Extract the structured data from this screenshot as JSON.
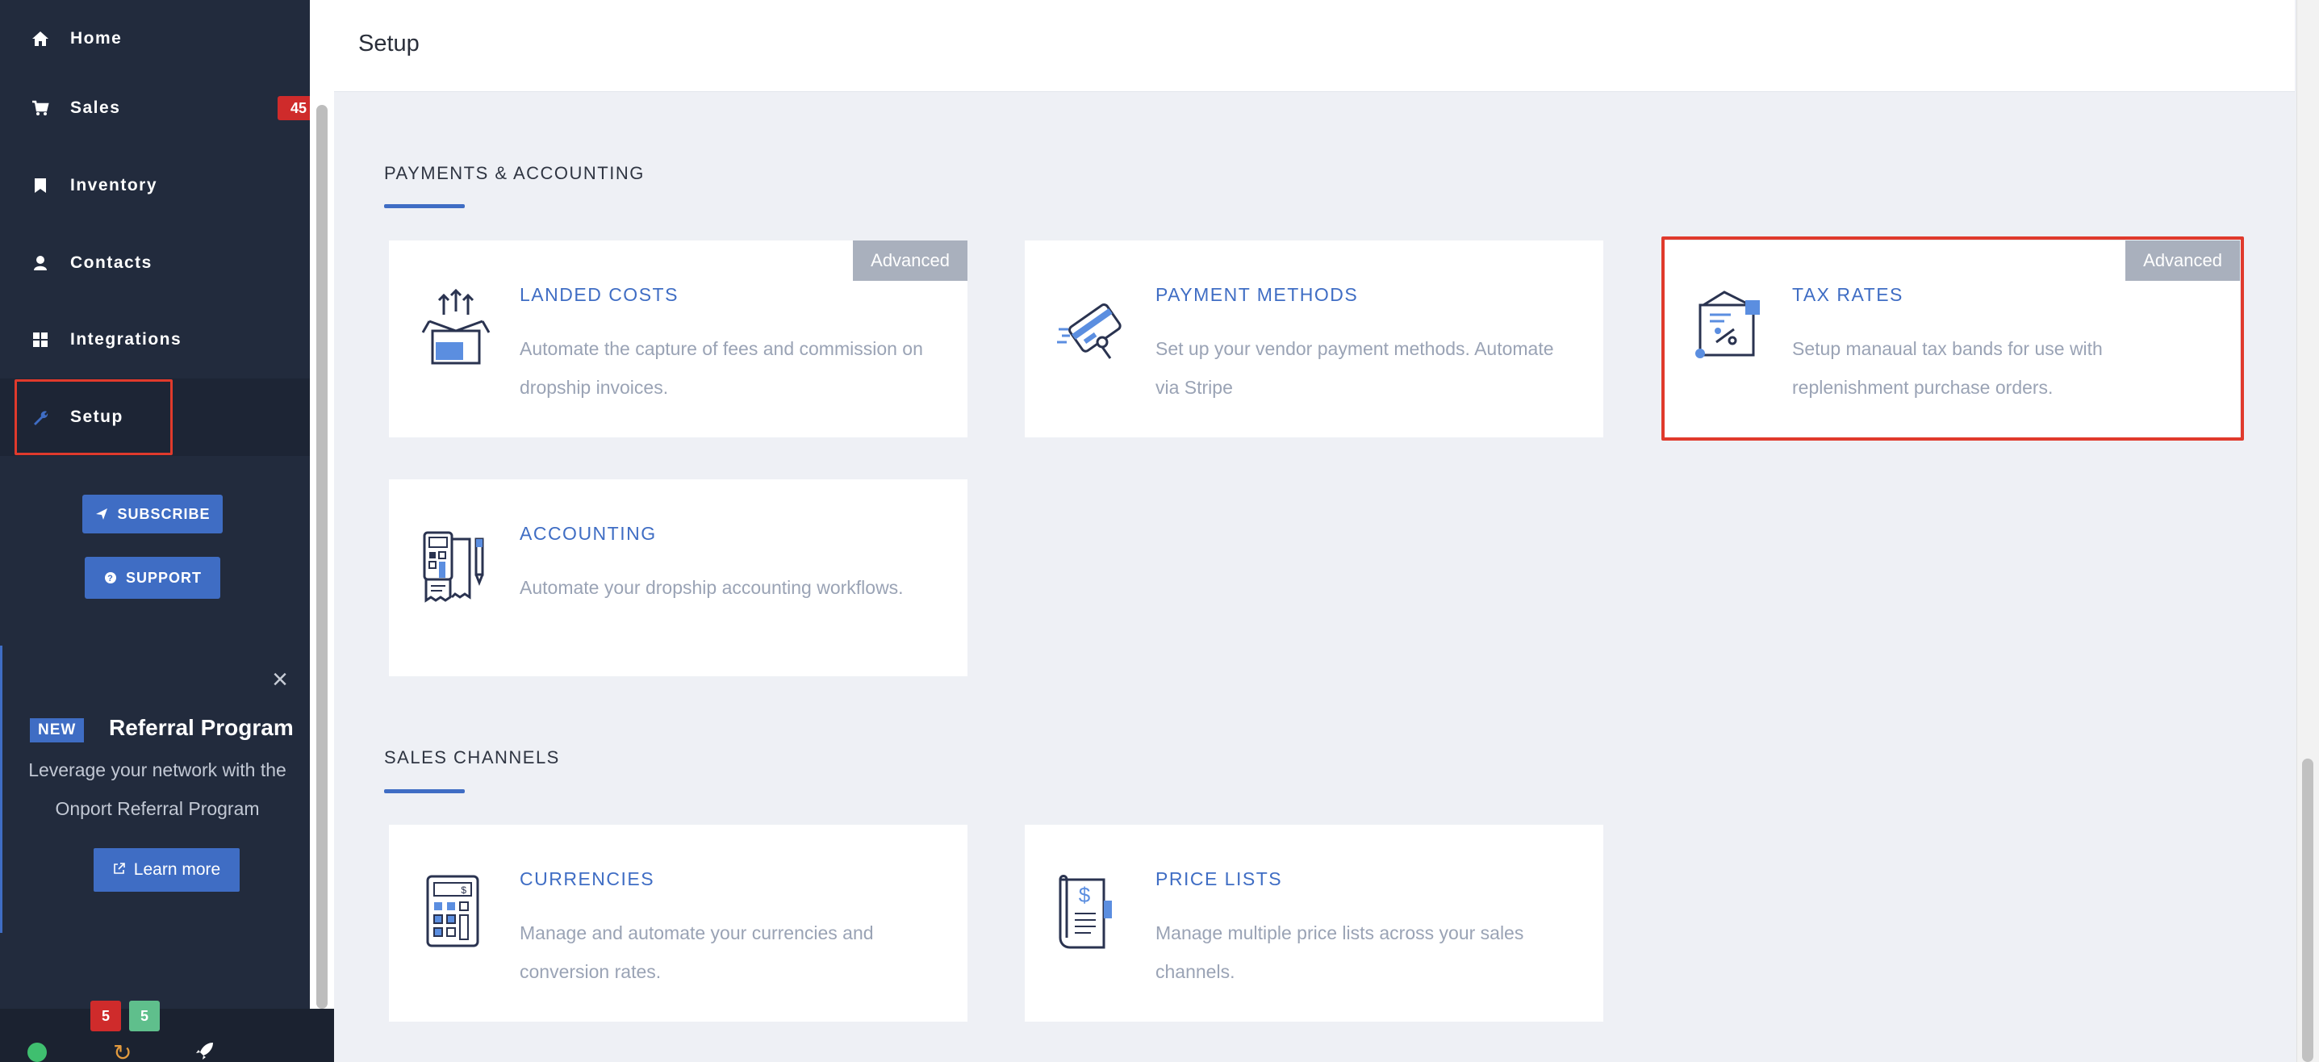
{
  "sidebar": {
    "items": [
      {
        "label": "Home",
        "icon": "home-icon"
      },
      {
        "label": "Sales",
        "icon": "cart-icon",
        "badge": "45"
      },
      {
        "label": "Inventory",
        "icon": "bookmark-icon"
      },
      {
        "label": "Contacts",
        "icon": "user-icon"
      },
      {
        "label": "Integrations",
        "icon": "grid-icon"
      },
      {
        "label": "Setup",
        "icon": "wrench-icon",
        "active": true
      }
    ],
    "subscribe_label": "SUBSCRIBE",
    "support_label": "SUPPORT"
  },
  "referral": {
    "new_tag": "NEW",
    "title": "Referral Program",
    "text": "Leverage your network with the Onport Referral Program",
    "button_label": "Learn more"
  },
  "bottom_bar": {
    "badge_red": "5",
    "badge_green": "5"
  },
  "header": {
    "title": "Setup"
  },
  "sections": {
    "payments": {
      "title": "PAYMENTS & ACCOUNTING",
      "cards": [
        {
          "title": "LANDED COSTS",
          "desc": "Automate the capture of fees and commission on dropship invoices.",
          "badge": "Advanced",
          "icon": "box-upload-icon"
        },
        {
          "title": "PAYMENT METHODS",
          "desc": "Set up your vendor payment methods. Automate via Stripe",
          "icon": "card-payment-icon"
        },
        {
          "title": "TAX RATES",
          "desc": "Setup manaual tax bands for use with replenishment purchase orders.",
          "badge": "Advanced",
          "icon": "tax-box-icon"
        },
        {
          "title": "ACCOUNTING",
          "desc": "Automate your dropship accounting workflows.",
          "icon": "calculator-receipt-icon"
        }
      ]
    },
    "sales_channels": {
      "title": "SALES CHANNELS",
      "cards": [
        {
          "title": "CURRENCIES",
          "desc": "Manage and automate your currencies and conversion rates.",
          "icon": "calculator-icon"
        },
        {
          "title": "PRICE LISTS",
          "desc": "Manage multiple price lists across your sales channels.",
          "icon": "price-list-icon"
        }
      ]
    }
  },
  "colors": {
    "sidebar_bg": "#222b3d",
    "accent": "#3f6dc4",
    "highlight": "#e03a2c",
    "badge_red": "#cf2b2b",
    "badge_green": "#5fbf8c"
  }
}
